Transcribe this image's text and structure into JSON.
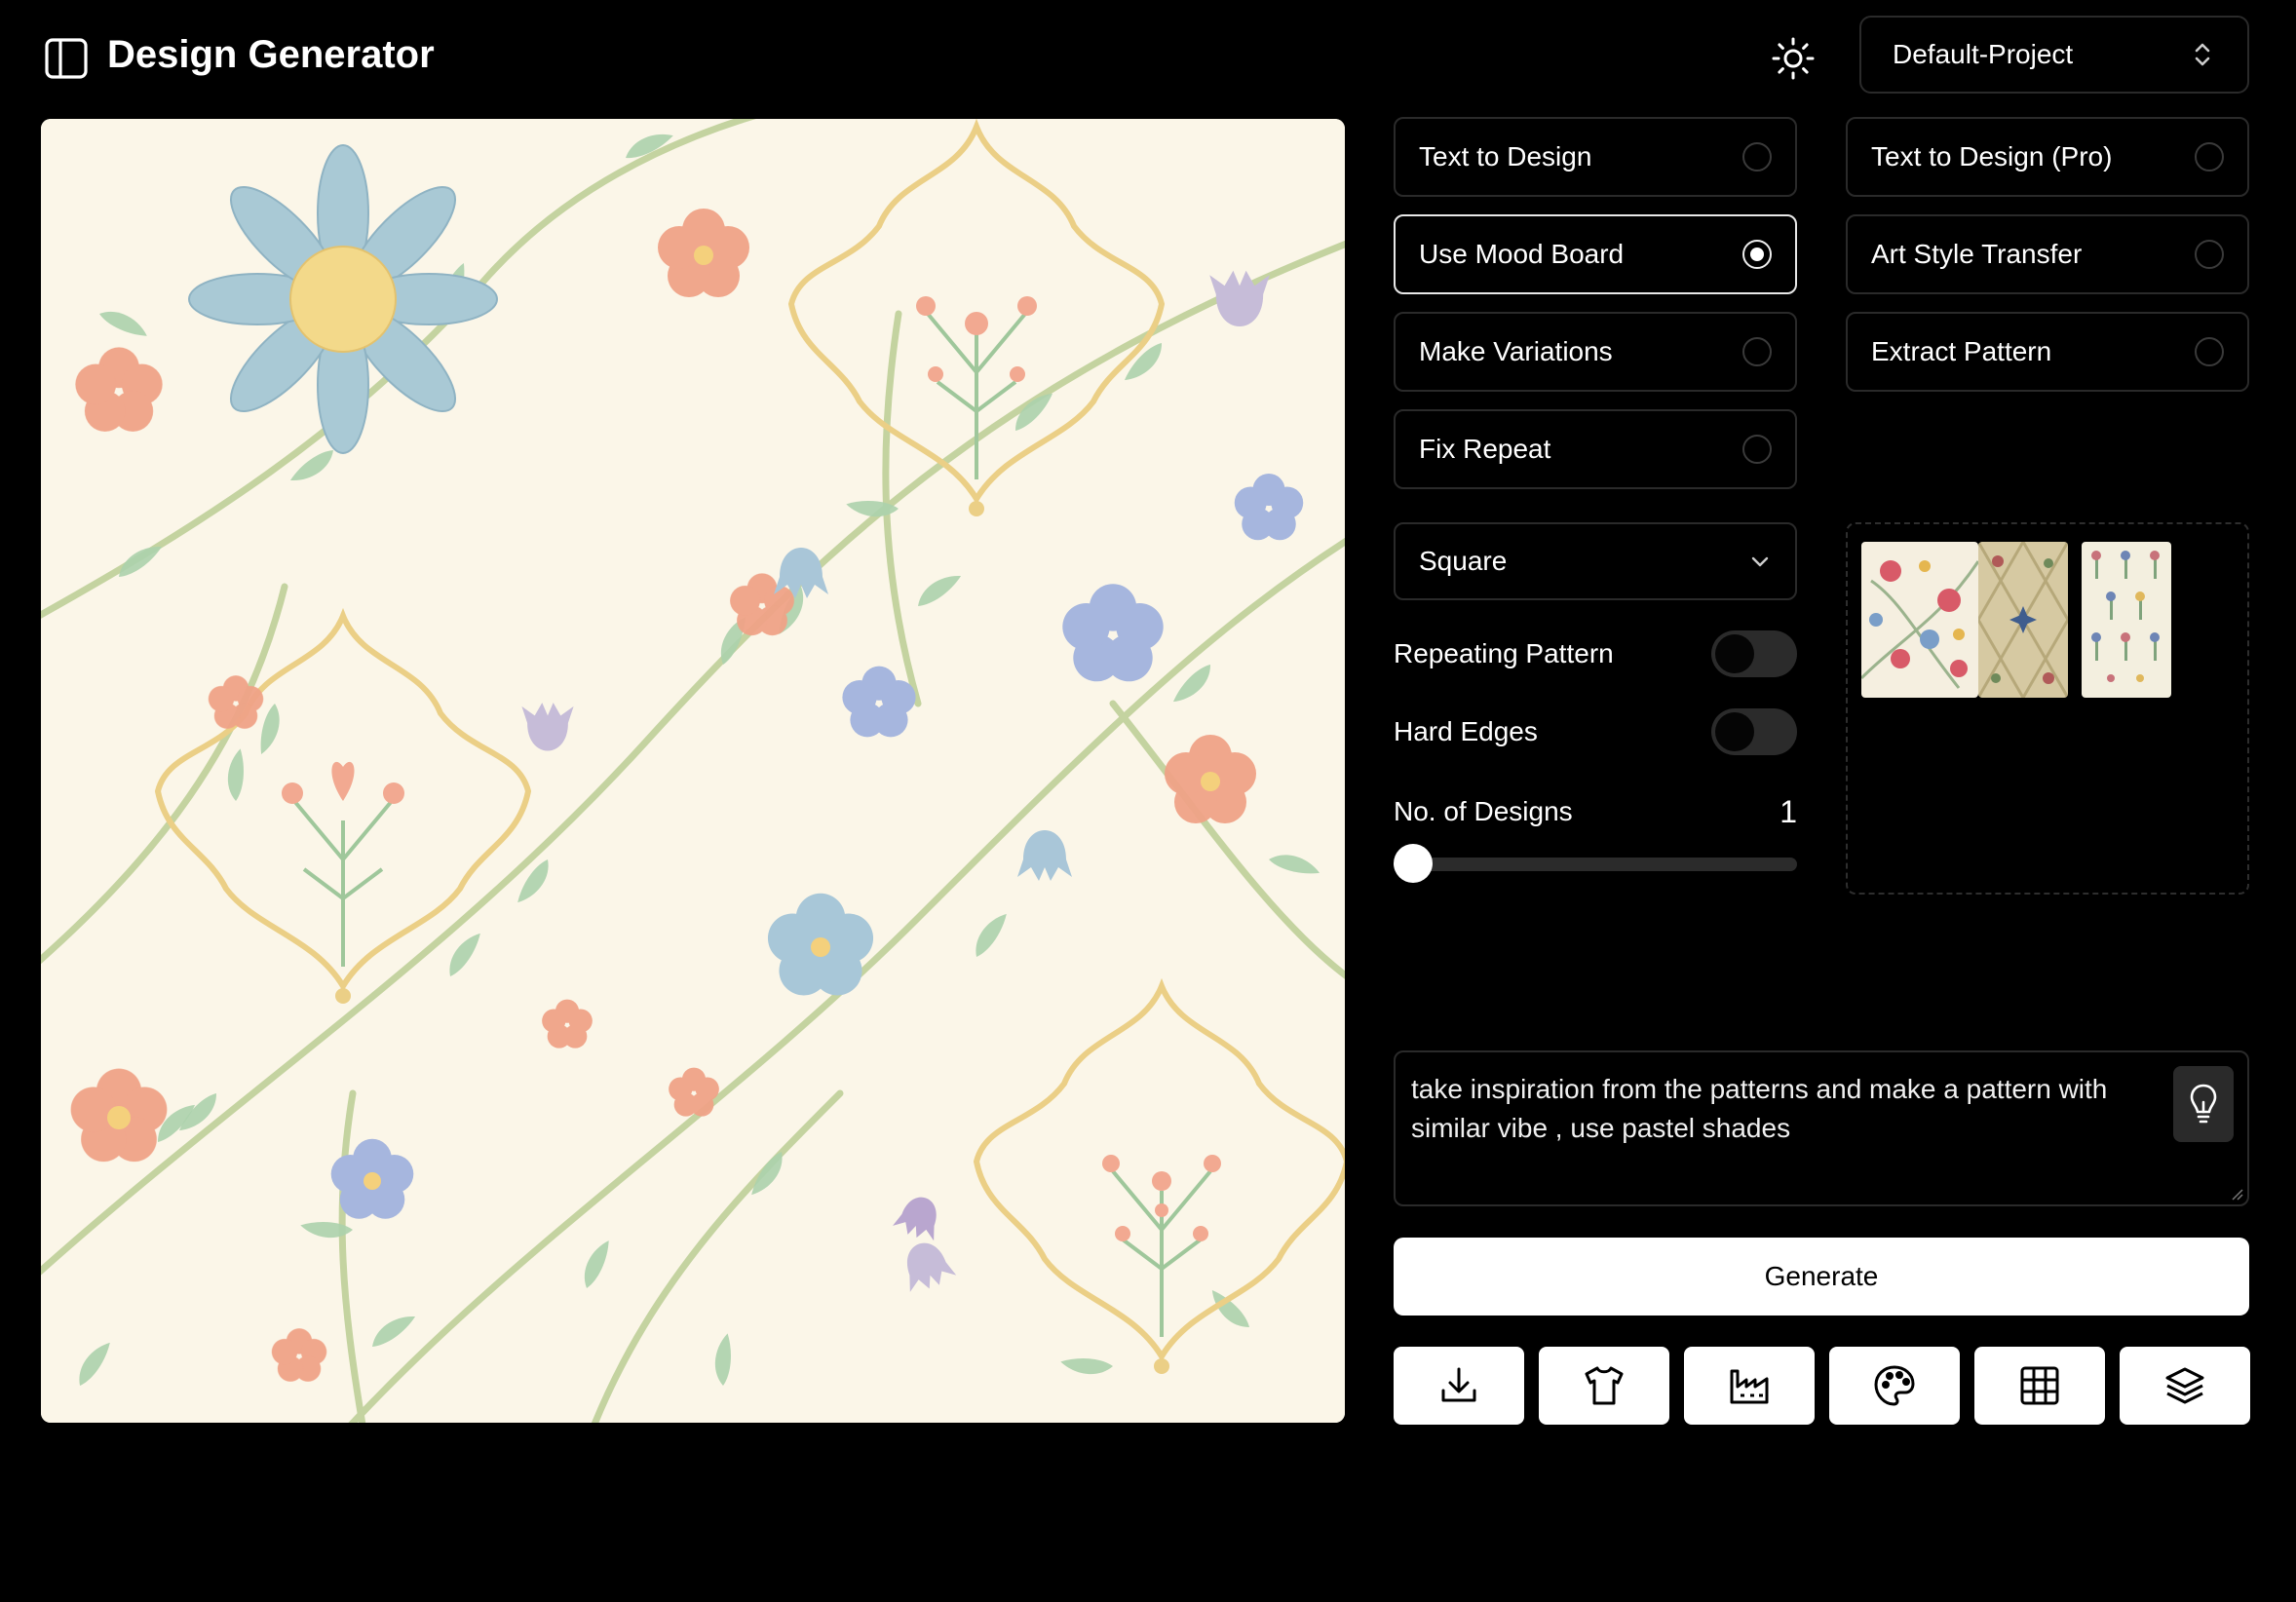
{
  "header": {
    "title": "Design Generator",
    "project": "Default-Project"
  },
  "modes": [
    {
      "label": "Text to Design",
      "selected": false
    },
    {
      "label": "Text to Design (Pro)",
      "selected": false
    },
    {
      "label": "Use Mood Board",
      "selected": true
    },
    {
      "label": "Art Style Transfer",
      "selected": false
    },
    {
      "label": "Make Variations",
      "selected": false
    },
    {
      "label": "Extract Pattern",
      "selected": false
    },
    {
      "label": "Fix Repeat",
      "selected": false
    }
  ],
  "options": {
    "aspect": "Square",
    "repeating_pattern_label": "Repeating Pattern",
    "repeating_pattern": false,
    "hard_edges_label": "Hard Edges",
    "hard_edges": false,
    "designs_label": "No. of Designs",
    "designs_count": "1"
  },
  "prompt": {
    "text": "take inspiration from the patterns and make a pattern with similar vibe , use pastel shades"
  },
  "actions": {
    "generate": "Generate",
    "tools": [
      "download-icon",
      "tshirt-icon",
      "factory-icon",
      "palette-icon",
      "grid-icon",
      "layers-icon"
    ]
  },
  "colors": {
    "background": "#000000",
    "canvas_bg": "#fbf6e8",
    "leaf": "#a9cfa8",
    "stem": "#b8cf98",
    "frame": "#ecd28a",
    "coral": "#ef9e84",
    "blue": "#a9c6d6",
    "lilac": "#c8bdd9",
    "periwinkle": "#a4b3dc"
  }
}
